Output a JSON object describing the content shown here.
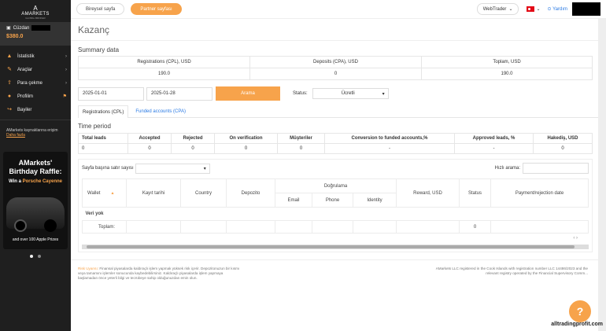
{
  "logo": {
    "mark": "A",
    "name": "AMARKETS",
    "sub": "GLOBAL BROKER"
  },
  "wallet": {
    "label": "Cüzdan",
    "amount": "$380.0"
  },
  "nav": [
    {
      "icon": "chart-icon",
      "label": "İstatistik"
    },
    {
      "icon": "tools-icon",
      "label": "Araçlar"
    },
    {
      "icon": "withdraw-icon",
      "label": "Para çekme"
    },
    {
      "icon": "user-icon",
      "label": "Profilim"
    },
    {
      "icon": "logout-icon",
      "label": "Bayiler"
    }
  ],
  "note": {
    "text": "AMarkets kaynaklarına erişim",
    "link": "Daha fazla"
  },
  "promo": {
    "title1": "AMarkets'",
    "title2": "Birthday Raffle:",
    "win_prefix": "Win a",
    "win_car": "Porsche Cayenne",
    "bottom": "and over 100 Apple Prizes"
  },
  "topbar": {
    "tab1": "Bireysel sayfa",
    "tab2": "Partner sayfası",
    "webtrader": "WebTrader",
    "help": "Yardım"
  },
  "page_title": "Kazanç",
  "summary": {
    "title": "Summary data",
    "headers": [
      "Registrations (CPL), USD",
      "Deposits (CPA), USD",
      "Toplam, USD"
    ],
    "values": [
      "190.0",
      "0",
      "190.0"
    ]
  },
  "filters": {
    "date_from": "2025-01-01",
    "date_to": "2025-01-28",
    "search_button": "Arama",
    "status_label": "Status:",
    "status_value": "Ücretli"
  },
  "subtabs": {
    "tab1": "Registrations (CPL)",
    "tab2": "Funded accounts (CPA)"
  },
  "period": {
    "title": "Time period",
    "headers": [
      "Total leads",
      "Accepted",
      "Rejected",
      "On verification",
      "Müşteriler",
      "Conversion to funded accounts,%",
      "Approved leads, %",
      "Hakediş, USD"
    ],
    "values": [
      "0",
      "0",
      "0",
      "0",
      "0",
      "-",
      "-",
      "0"
    ]
  },
  "table_ctrl": {
    "rows_label": "Sayfa başına satır sayısı",
    "search_label": "Hızlı arama:"
  },
  "data_table": {
    "headers": [
      "Wallet",
      "Kayıt tarihi",
      "Country",
      "Depozito",
      "Doğrulama",
      "Reward, USD",
      "Status",
      "Payment/rejection date"
    ],
    "verify_sub": [
      "Email",
      "Phone",
      "Identity"
    ],
    "empty": "Veri yok",
    "total_label": "Toplam:",
    "total_status": "0"
  },
  "footer": {
    "risk_label": "Risk Uyarısı:",
    "risk_text": "Finansal piyasalarda kaldıraçlı işlem yapmak yüksek risk içerir. Depozitonuzun bir kısmı veya tamamını işlemler sonucunda kaybedebilirsiniz. Kaldıraçlı piyasalarda işlem yapmaya başlamadan önce yeterli bilgi ve tecrübeye sahip olduğunuzdan emin olun.",
    "right_text": "AMarkets LLC registered in the Cook Islands with registration number LLC 14486/2023 and the relevant registry operated by the Financial Supervisory Comm..."
  },
  "watermark": "alltradingprofit.com"
}
